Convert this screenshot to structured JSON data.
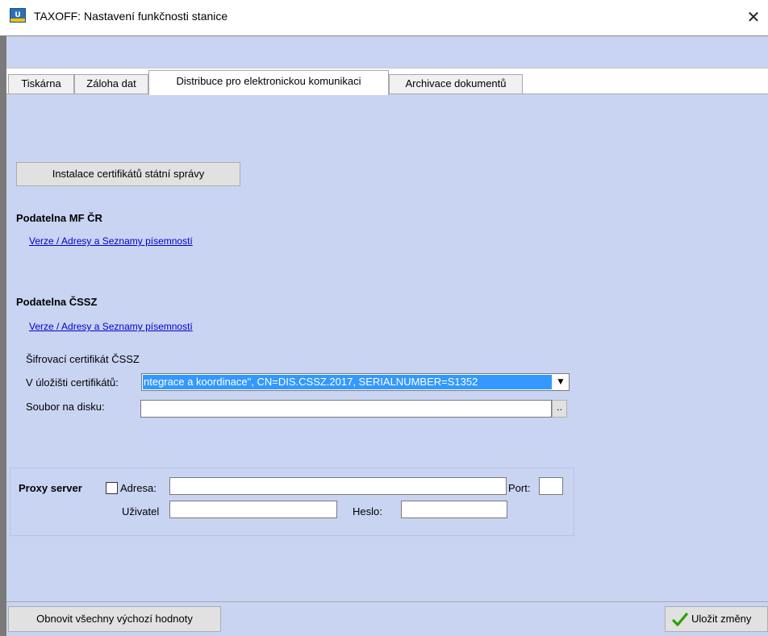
{
  "window": {
    "icon_text": "U",
    "title": "TAXOFF: Nastavení funkčnosti stanice",
    "close_glyph": "✕"
  },
  "tabs": [
    {
      "label": "Tiskárna"
    },
    {
      "label": "Záloha dat"
    },
    {
      "label": "Distribuce pro elektronickou komunikaci"
    },
    {
      "label": "Archivace dokumentů"
    }
  ],
  "active_tab": 2,
  "content": {
    "install_button": "Instalace certifikátů státní správy",
    "mf": {
      "heading": "Podatelna MF ČR",
      "link": "Verze / Adresy a Seznamy písemností"
    },
    "cssz": {
      "heading": "Podatelna ČSSZ",
      "link": "Verze / Adresy a Seznamy písemností",
      "cert_label": "Šifrovací certifikát ČSSZ",
      "store_label": "V úložišti certifikátů:",
      "store_value": "ntegrace a koordinace\", CN=DIS.CSSZ.2017, SERIALNUMBER=S1352",
      "file_label": "Soubor na disku:",
      "file_value": "",
      "browse_label": ".."
    },
    "proxy": {
      "title": "Proxy server",
      "enabled": false,
      "address_label": "Adresa:",
      "address_value": "",
      "port_label": "Port:",
      "port_value": "",
      "user_label": "Uživatel",
      "user_value": "",
      "password_label": "Heslo:",
      "password_value": ""
    }
  },
  "footer": {
    "reset_button": "Obnovit všechny výchozí hodnoty",
    "save_button": "Uložit změny",
    "save_icon": "check-icon"
  },
  "colors": {
    "panel": "#c9d4f2",
    "link": "#0000cc",
    "selection": "#3399ff",
    "check": "#2aa000"
  }
}
